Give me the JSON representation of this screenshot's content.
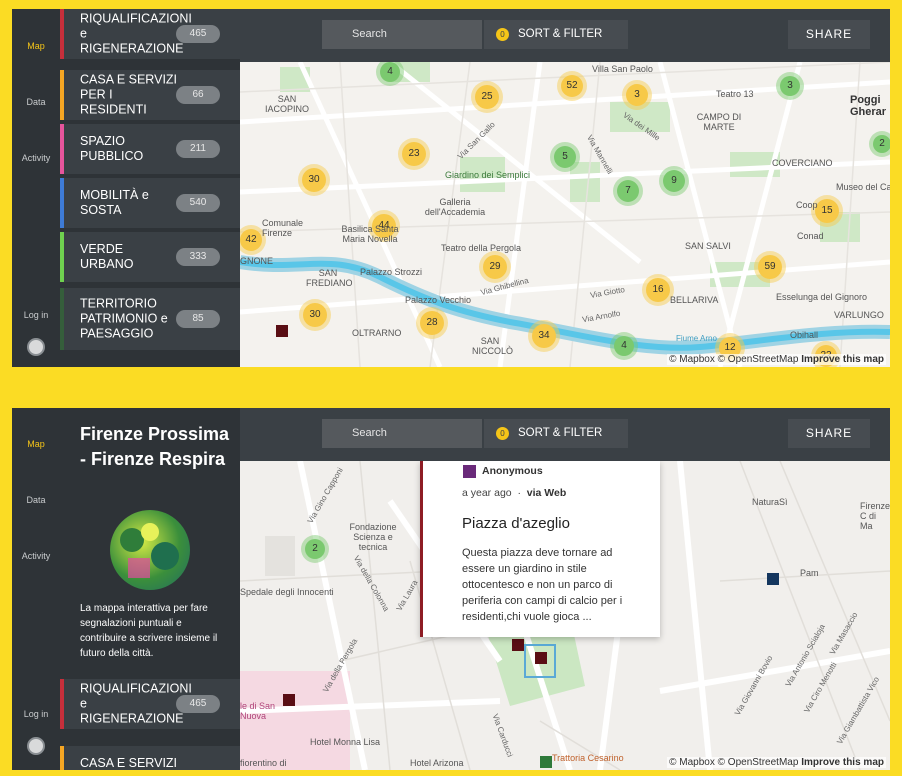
{
  "nav": {
    "map": "Map",
    "data": "Data",
    "activity": "Activity",
    "login": "Log in"
  },
  "categories": [
    {
      "label": "RIQUALIFICAZIONI e RIGENERAZIONE",
      "count": "465",
      "color": "#c62f3b"
    },
    {
      "label": "CASA E SERVIZI PER I RESIDENTI",
      "count": "66",
      "color": "#f5a623"
    },
    {
      "label": "SPAZIO PUBBLICO",
      "count": "211",
      "color": "#e7559c"
    },
    {
      "label": "MOBILITÀ e SOSTA",
      "count": "540",
      "color": "#3e7bd6"
    },
    {
      "label": "VERDE URBANO",
      "count": "333",
      "color": "#6fd14f"
    },
    {
      "label": "TERRITORIO PATRIMONIO e PAESAGGIO",
      "count": "85",
      "color": "#355e3b"
    }
  ],
  "bottom_categories": [
    {
      "label": "RIQUALIFICAZIONI e RIGENERAZIONE",
      "count": "465",
      "color": "#c62f3b"
    },
    {
      "label": "CASA E SERVIZI",
      "count": "",
      "color": "#f5a623"
    }
  ],
  "toolbar": {
    "search_placeholder": "Search",
    "filter_count": "0",
    "sort_label": "SORT & FILTER",
    "share_label": "SHARE"
  },
  "clusters_top": [
    {
      "n": "4",
      "c": "g"
    },
    {
      "n": "52",
      "c": "y"
    },
    {
      "n": "3",
      "c": "y"
    },
    {
      "n": "3",
      "c": "g"
    },
    {
      "n": "25",
      "c": "y"
    },
    {
      "n": "2",
      "c": "g"
    },
    {
      "n": "23",
      "c": "y"
    },
    {
      "n": "5",
      "c": "g"
    },
    {
      "n": "30",
      "c": "y"
    },
    {
      "n": "7",
      "c": "g"
    },
    {
      "n": "9",
      "c": "g"
    },
    {
      "n": "15",
      "c": "y"
    },
    {
      "n": "44",
      "c": "y"
    },
    {
      "n": "42",
      "c": "y"
    },
    {
      "n": "29",
      "c": "y"
    },
    {
      "n": "59",
      "c": "y"
    },
    {
      "n": "16",
      "c": "y"
    },
    {
      "n": "30",
      "c": "y"
    },
    {
      "n": "28",
      "c": "y"
    },
    {
      "n": "34",
      "c": "y"
    },
    {
      "n": "4",
      "c": "g"
    },
    {
      "n": "12",
      "c": "y"
    },
    {
      "n": "22",
      "c": "y"
    }
  ],
  "places_top": [
    "Villa San Paolo",
    "Teatro 13",
    "CAMPO DI MARTE",
    "Poggi Gherar",
    "SAN IACOPINO",
    "Giardino dei Semplici",
    "COVERCIANO",
    "Museo del Ca",
    "Galleria dell'Accademia",
    "Comunale Firenze",
    "Basilica Santa Maria Novella",
    "Coop",
    "Conad",
    "Teatro della Pergola",
    "SAN SALVI",
    "GNONE",
    "Palazzo Strozzi",
    "SAN FREDIANO",
    "BELLARIVA",
    "Esselunga del Gignoro",
    "Palazzo Vecchio",
    "VARLUNGO",
    "OLTRARNO",
    "SAN NICCOLÒ",
    "Obihall",
    "Fiume Arno"
  ],
  "streets_top": [
    "Via San Gallo",
    "Via Mannelli",
    "Via dei Mille",
    "Via Ghibellina",
    "Via Giotto",
    "Via Arnolfo"
  ],
  "attribution": {
    "mapbox": "© Mapbox",
    "osm": "© OpenStreetMap",
    "improve": "Improve this map"
  },
  "project": {
    "title": "Firenze Prossima - Firenze Respira",
    "description": "La mappa interattiva per fare segnalazioni puntuali e contribuire a scrivere insieme il futuro della città."
  },
  "popup": {
    "user": "Anonymous",
    "time": "a year ago",
    "source": "via Web",
    "title": "Piazza d'azeglio",
    "body": "Questa piazza deve tornare ad essere un giardino in stile ottocentesco e non un parco di periferia con campi di calcio per i residenti,chi vuole gioca ..."
  },
  "clusters_bottom": [
    {
      "n": "2",
      "c": "g"
    }
  ],
  "places_bottom": [
    "Fondazione Scienza e tecnica",
    "Spedale degli Innocenti",
    "NaturaSì",
    "Firenze C di Ma",
    "Pam",
    "Hotel Monna Lisa",
    "Hotel Arizona",
    "Trattoria Cesarino",
    "le di San Nuova",
    "fiorentino di"
  ],
  "streets_bottom": [
    "Via Gino Capponi",
    "Via della Colonna",
    "Via Laura",
    "Via della Pergola",
    "Via Masaccio",
    "Via Giovanni Bovio",
    "Via Antonio Scialoja",
    "Via Ciro Menotti",
    "Via Giambattista Vico",
    "Via Carducci"
  ]
}
